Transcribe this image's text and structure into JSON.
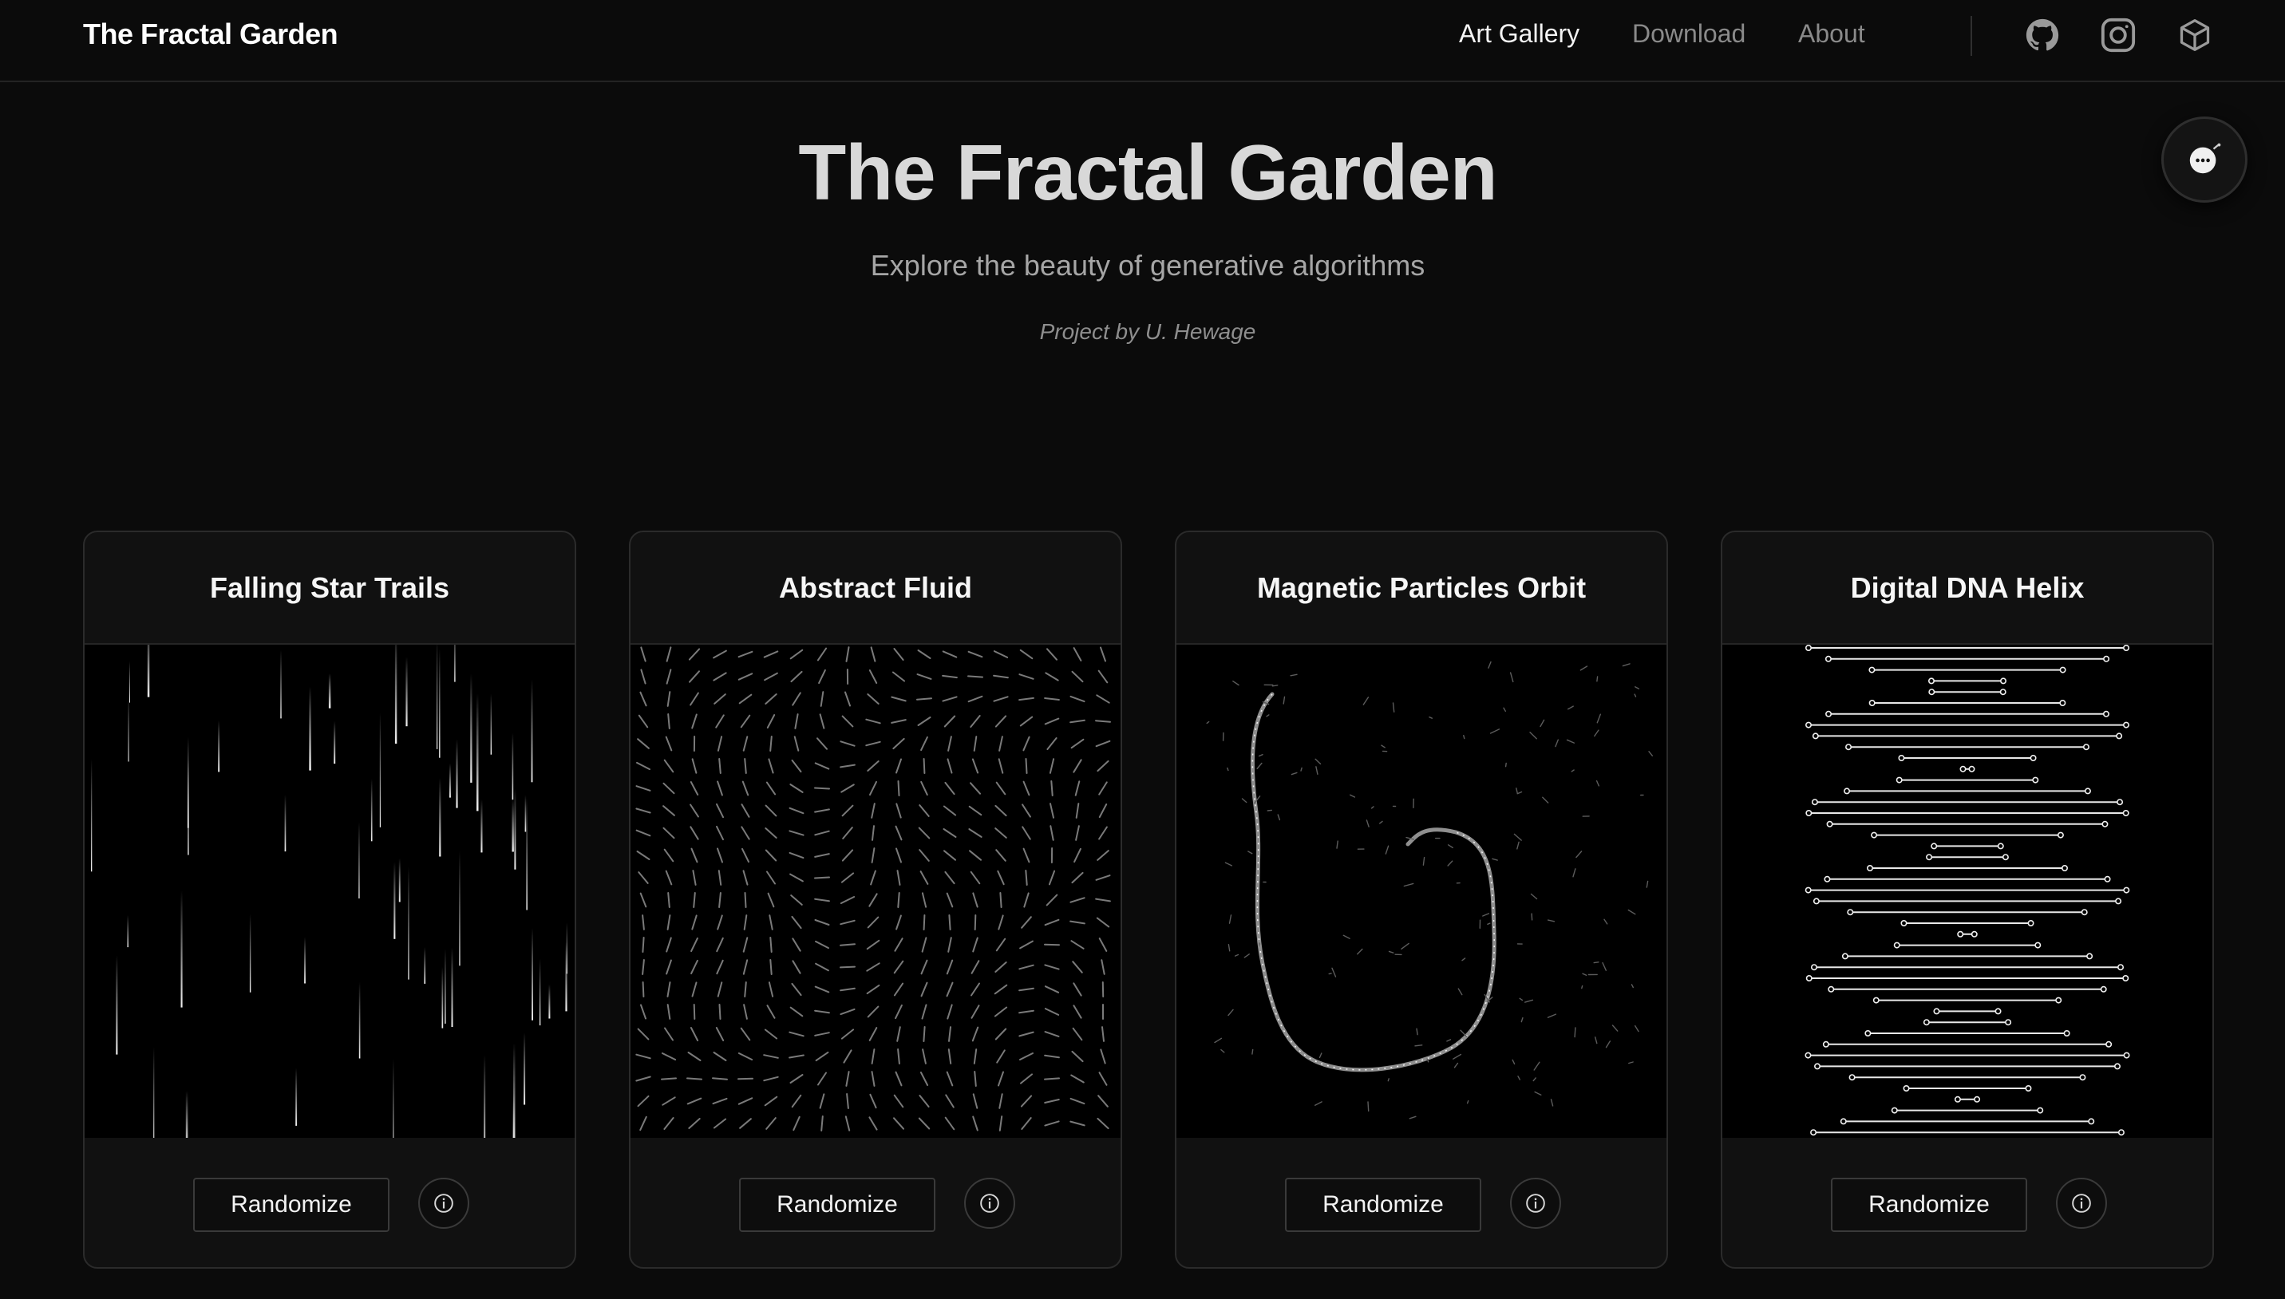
{
  "header": {
    "brand": "The Fractal Garden",
    "nav": [
      {
        "label": "Art Gallery",
        "active": true
      },
      {
        "label": "Download",
        "active": false
      },
      {
        "label": "About",
        "active": false
      }
    ],
    "icons": [
      "github-icon",
      "instagram-icon",
      "cube-icon"
    ]
  },
  "chat": {
    "icon": "chat-bubble-icon"
  },
  "hero": {
    "title": "The Fractal Garden",
    "subtitle": "Explore the beauty of generative algorithms",
    "credit": "Project by U. Hewage"
  },
  "gallery": {
    "cards": [
      {
        "title": "Falling Star Trails",
        "button_label": "Randomize",
        "info_icon": "info-icon"
      },
      {
        "title": "Abstract Fluid",
        "button_label": "Randomize",
        "info_icon": "info-icon"
      },
      {
        "title": "Magnetic Particles Orbit",
        "button_label": "Randomize",
        "info_icon": "info-icon"
      },
      {
        "title": "Digital DNA Helix",
        "button_label": "Randomize",
        "info_icon": "info-icon"
      }
    ]
  },
  "colors": {
    "background": "#0b0b0b",
    "card": "#111111",
    "border": "#2b2b2b",
    "text": "#f2f2f2",
    "muted": "#8a8a8a"
  }
}
